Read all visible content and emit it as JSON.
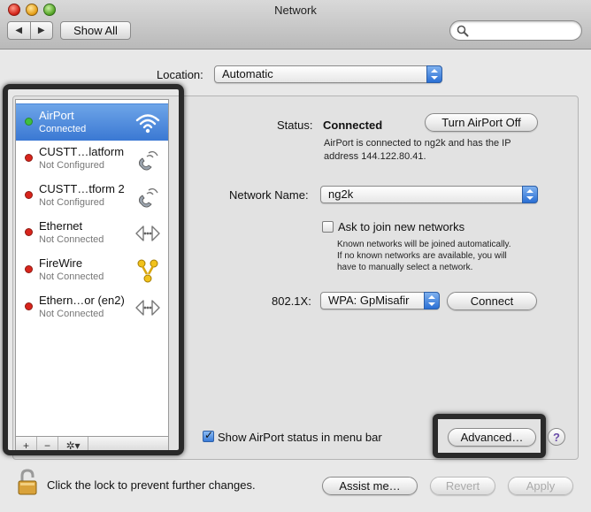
{
  "window": {
    "title": "Network"
  },
  "toolbar": {
    "back_glyph": "◀",
    "forward_glyph": "▶",
    "show_all_label": "Show All",
    "search_icon": "magnifier-icon"
  },
  "location": {
    "label": "Location:",
    "value": "Automatic"
  },
  "services": [
    {
      "name": "AirPort",
      "status": "Connected",
      "dot_color": "#3fbf3f",
      "icon": "wifi-icon",
      "selected": true
    },
    {
      "name": "CUSTT…latform",
      "status": "Not Configured",
      "dot_color": "#d8241c",
      "icon": "phone-icon",
      "selected": false
    },
    {
      "name": "CUSTT…tform 2",
      "status": "Not Configured",
      "dot_color": "#d8241c",
      "icon": "phone-icon",
      "selected": false
    },
    {
      "name": "Ethernet",
      "status": "Not Connected",
      "dot_color": "#d8241c",
      "icon": "ethernet-icon",
      "selected": false
    },
    {
      "name": "FireWire",
      "status": "Not Connected",
      "dot_color": "#d8241c",
      "icon": "firewire-icon",
      "selected": false
    },
    {
      "name": "Ethern…or (en2)",
      "status": "Not Connected",
      "dot_color": "#d8241c",
      "icon": "ethernet-icon",
      "selected": false
    }
  ],
  "sidebar_toolbar": {
    "add": "+",
    "remove": "−",
    "action": "✲▾"
  },
  "detail": {
    "status_label": "Status:",
    "status_value": "Connected",
    "turn_off_label": "Turn AirPort Off",
    "status_line1": "AirPort is connected to ng2k and has the IP",
    "status_line2": "address 144.122.80.41.",
    "network_name_label": "Network Name:",
    "network_name_value": "ng2k",
    "ask_join_label": "Ask to join new networks",
    "ask_join_line1": "Known networks will be joined automatically.",
    "ask_join_line2": "If no known networks are available, you will",
    "ask_join_line3": "have to manually select a network.",
    "dot1x_label": "802.1X:",
    "dot1x_value": "WPA: GpMisafir",
    "connect_label": "Connect",
    "show_status_label": "Show AirPort status in menu bar",
    "advanced_label": "Advanced…",
    "help_label": "?"
  },
  "bottom": {
    "lock_text": "Click the lock to prevent further changes.",
    "assist_label": "Assist me…",
    "revert_label": "Revert",
    "apply_label": "Apply"
  },
  "colors": {
    "selection": "#3a78d3",
    "connected": "#3fbf3f",
    "disconnected": "#d8241c"
  }
}
